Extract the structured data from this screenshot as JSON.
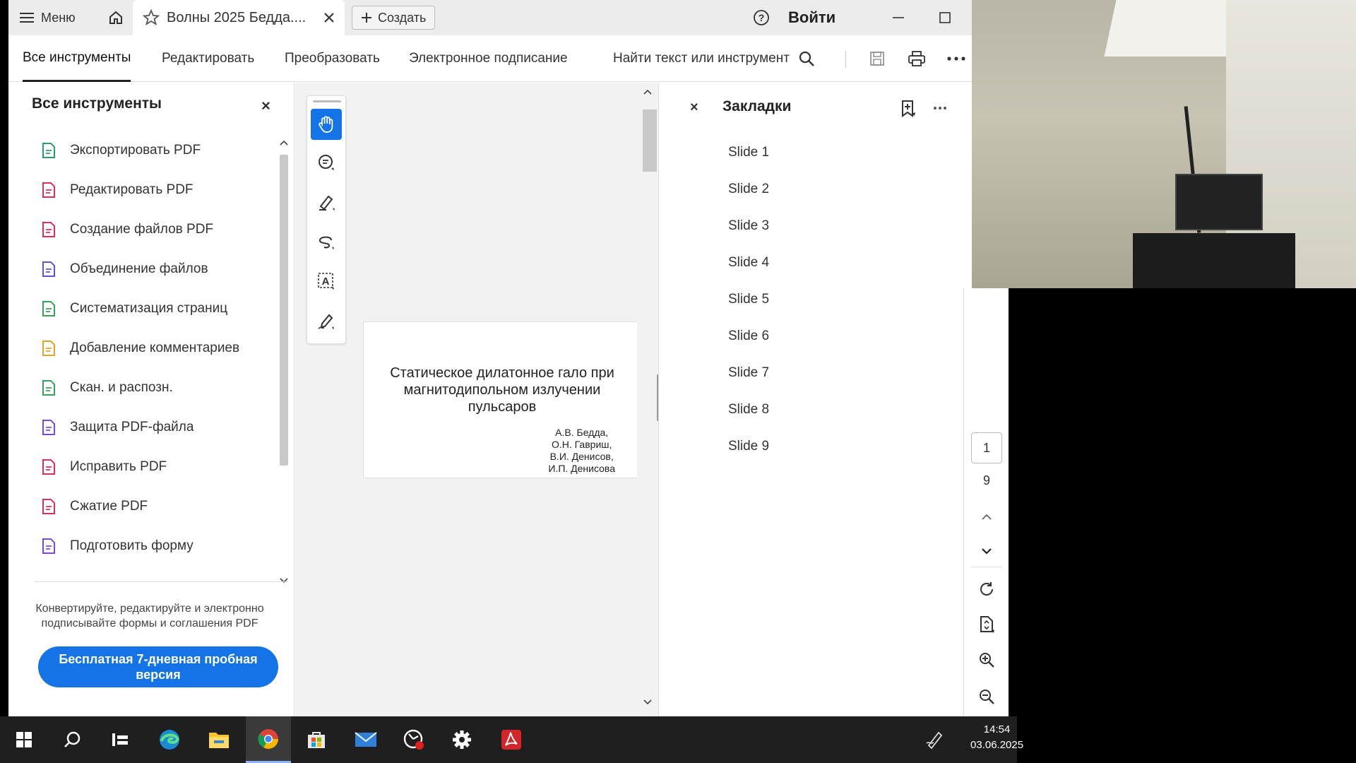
{
  "titlebar": {
    "menu_label": "Меню",
    "tab_title": "Волны 2025 Бедда....",
    "create_label": "Создать",
    "signin_label": "Войти"
  },
  "toolbar": {
    "tabs": [
      {
        "label": "Все инструменты"
      },
      {
        "label": "Редактировать"
      },
      {
        "label": "Преобразовать"
      },
      {
        "label": "Электронное подписание"
      }
    ],
    "search_label": "Найти текст или инструмент"
  },
  "left_panel": {
    "title": "Все инструменты",
    "close_label": "×",
    "items": [
      {
        "label": "Экспортировать PDF",
        "icon": "export-pdf-icon",
        "color": "#2e9a6f"
      },
      {
        "label": "Редактировать PDF",
        "icon": "edit-pdf-icon",
        "color": "#d8315b"
      },
      {
        "label": "Создание файлов PDF",
        "icon": "create-pdf-icon",
        "color": "#d8315b"
      },
      {
        "label": "Объединение файлов",
        "icon": "combine-files-icon",
        "color": "#5a55d6"
      },
      {
        "label": "Систематизация страниц",
        "icon": "organize-pages-icon",
        "color": "#3aa35a"
      },
      {
        "label": "Добавление комментариев",
        "icon": "comment-icon",
        "color": "#e0a526"
      },
      {
        "label": "Скан. и распозн.",
        "icon": "scan-ocr-icon",
        "color": "#3aa35a"
      },
      {
        "label": "Защита PDF-файла",
        "icon": "protect-pdf-icon",
        "color": "#7b4ad6"
      },
      {
        "label": "Исправить PDF",
        "icon": "redact-pdf-icon",
        "color": "#d8315b"
      },
      {
        "label": "Сжатие PDF",
        "icon": "compress-pdf-icon",
        "color": "#d8315b"
      },
      {
        "label": "Подготовить форму",
        "icon": "prepare-form-icon",
        "color": "#7b4ad6"
      }
    ],
    "promo_text": "Конвертируйте, редактируйте и электронно подписывайте формы и соглашения PDF",
    "trial_button": "Бесплатная 7-дневная пробная версия"
  },
  "document": {
    "title": "Статическое дилатонное гало при магнитодипольном излучении пульсаров",
    "authors": [
      "А.В. Бедда,",
      "О.Н. Гавриш,",
      "В.И. Денисов,",
      "И.П. Денисова"
    ]
  },
  "bookmarks": {
    "close_label": "×",
    "title": "Закладки",
    "items": [
      "Slide 1",
      "Slide 2",
      "Slide 3",
      "Slide 4",
      "Slide 5",
      "Slide 6",
      "Slide 7",
      "Slide 8",
      "Slide 9"
    ]
  },
  "page_nav": {
    "current_page": "1",
    "total_pages": "9"
  },
  "taskbar": {
    "time": "14:54",
    "date": "03.06.2025"
  },
  "colors": {
    "accent": "#1473e6"
  }
}
